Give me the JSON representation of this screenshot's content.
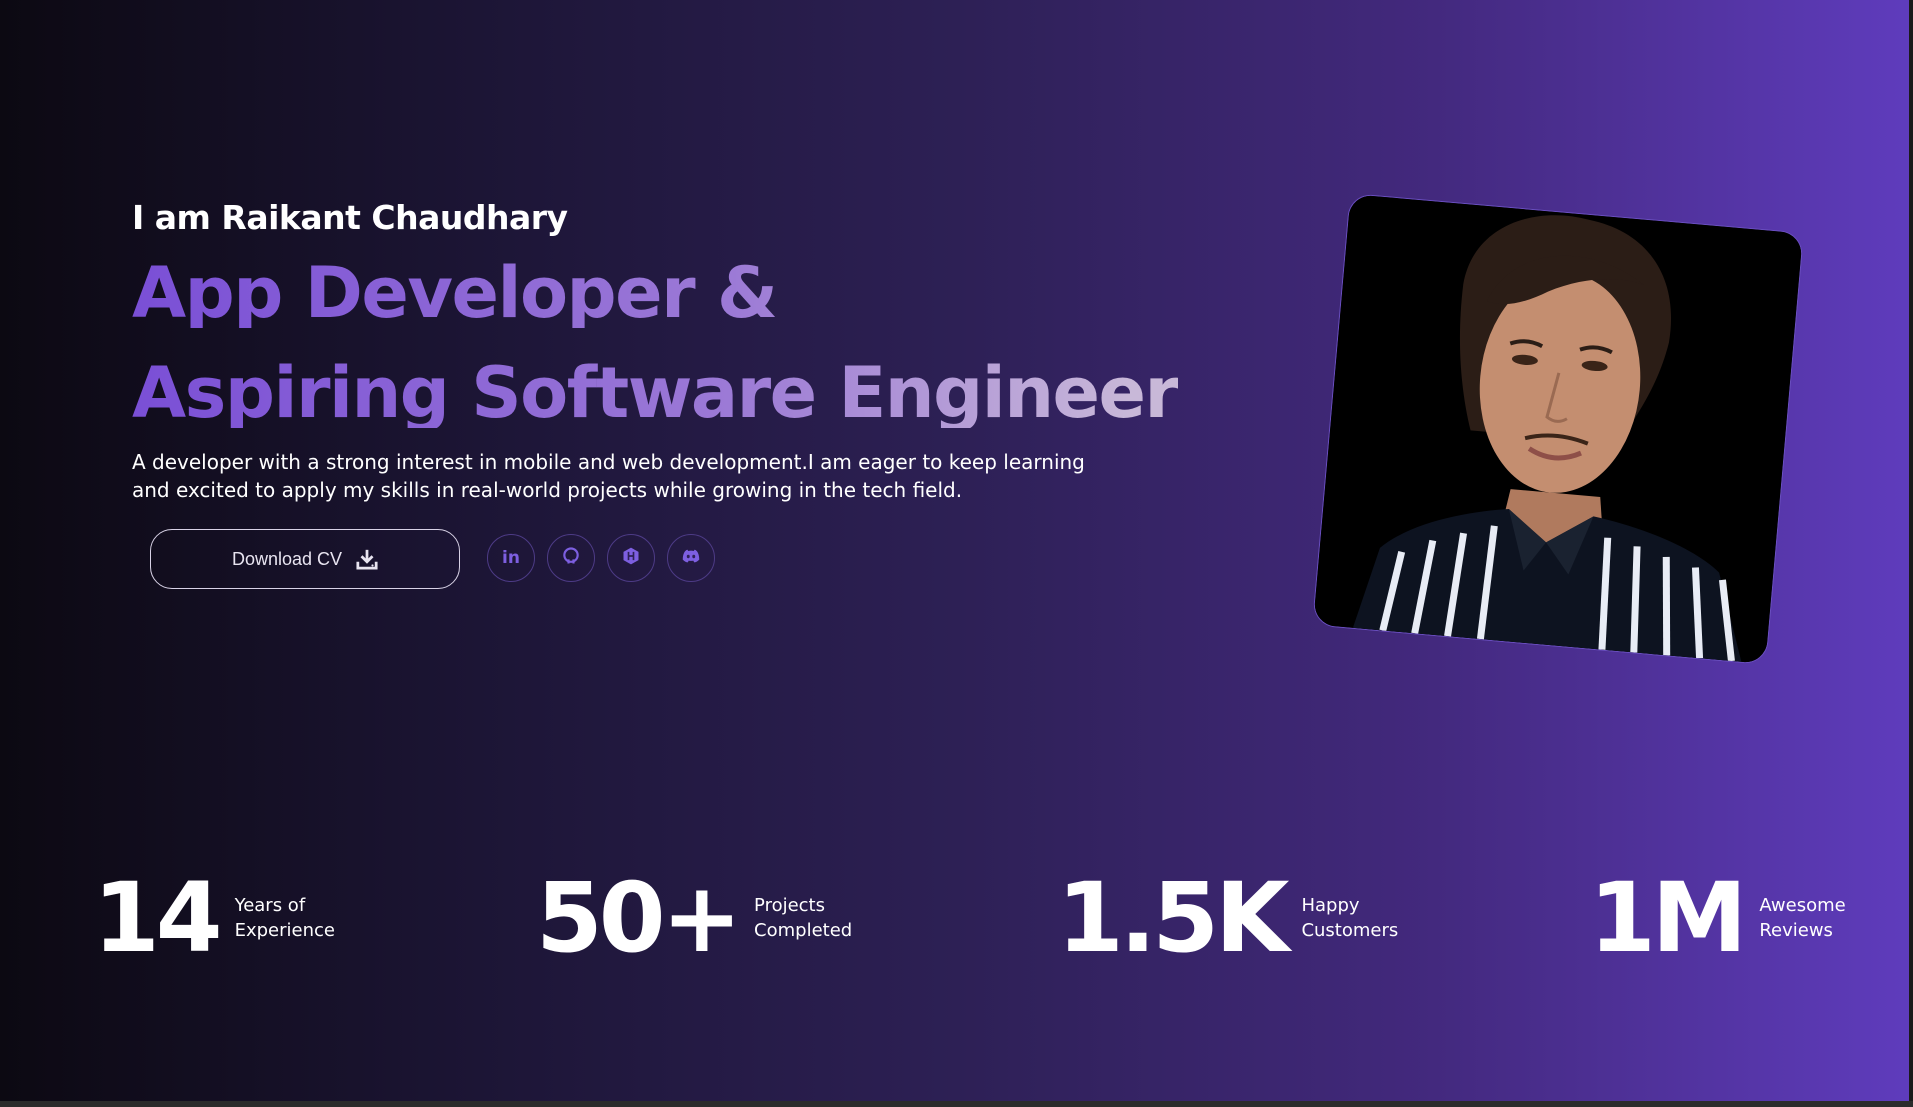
{
  "hero": {
    "intro": "I am Raikant Chaudhary",
    "headline_line1": "App Developer &",
    "headline_line2": "Aspiring Software Engineer",
    "description": "A developer with a strong interest in mobile and web development.I am eager to keep learning and excited to apply my skills in real-world projects while growing in the tech field.",
    "download_label": "Download CV",
    "download_icon": "download-icon",
    "socials": [
      {
        "name": "linkedin-icon",
        "label": "in"
      },
      {
        "name": "github-icon",
        "label": ""
      },
      {
        "name": "hackerrank-icon",
        "label": "H"
      },
      {
        "name": "discord-icon",
        "label": ""
      }
    ],
    "photo_description_icon": "profile-photo"
  },
  "stats": [
    {
      "number": "14",
      "label_line1": "Years of",
      "label_line2": "Experience"
    },
    {
      "number": "50+",
      "label_line1": "Projects",
      "label_line2": "Completed"
    },
    {
      "number": "1.5K",
      "label_line1": "Happy",
      "label_line2": "Customers"
    },
    {
      "number": "1M",
      "label_line1": "Awesome",
      "label_line2": "Reviews"
    }
  ],
  "colors": {
    "accent": "#7d5fe0",
    "gradient_start": "#0c0912",
    "gradient_end": "#5f3cbd"
  }
}
